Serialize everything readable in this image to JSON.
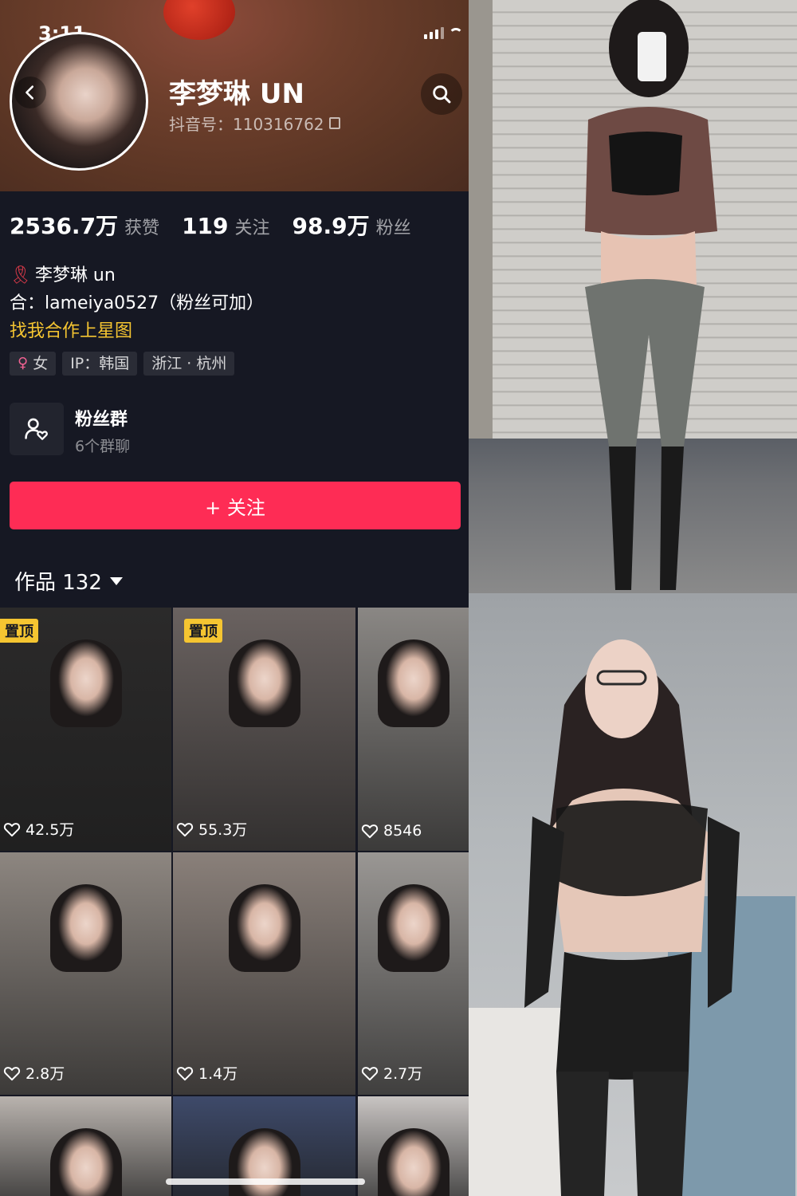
{
  "status_bar": {
    "time": "3:11"
  },
  "profile": {
    "name": "李梦琳 UN",
    "id_label": "抖音号：110316762",
    "stats": [
      {
        "value": "2536.7万",
        "label": "获赞"
      },
      {
        "value": "119",
        "label": "关注"
      },
      {
        "value": "98.9万",
        "label": "粉丝"
      }
    ],
    "bio": {
      "line1": "李梦琳 un",
      "line2": "合：lameiya0527（粉丝可加）",
      "line3": "找我合作上星图"
    },
    "tags": [
      "女",
      "IP：韩国",
      "浙江 · 杭州"
    ],
    "fan_group": {
      "title": "粉丝群",
      "subtitle": "6个群聊"
    },
    "follow_button": "+ 关注",
    "works_label": "作品 132",
    "pinned_label": "置顶"
  },
  "videos": [
    {
      "likes": "42.5万",
      "pinned": true,
      "bg": "#2b2a2a"
    },
    {
      "likes": "55.3万",
      "pinned": true,
      "bg": "#6a6260"
    },
    {
      "likes": "8546",
      "pinned": false,
      "bg": "#8a8784"
    },
    {
      "likes": "2.8万",
      "pinned": false,
      "bg": "#8d8680"
    },
    {
      "likes": "1.4万",
      "pinned": false,
      "bg": "#8a807a"
    },
    {
      "likes": "2.7万",
      "pinned": false,
      "bg": "#9a9794"
    },
    {
      "likes": "",
      "pinned": false,
      "bg": "#b9b3ae"
    },
    {
      "likes": "",
      "pinned": false,
      "bg": "#3e4a6a"
    },
    {
      "likes": "",
      "pinned": false,
      "bg": "#c8c4c2"
    }
  ],
  "colors": {
    "background": "#161823",
    "accent": "#fe2c55",
    "pinned_badge": "#f5c531"
  }
}
